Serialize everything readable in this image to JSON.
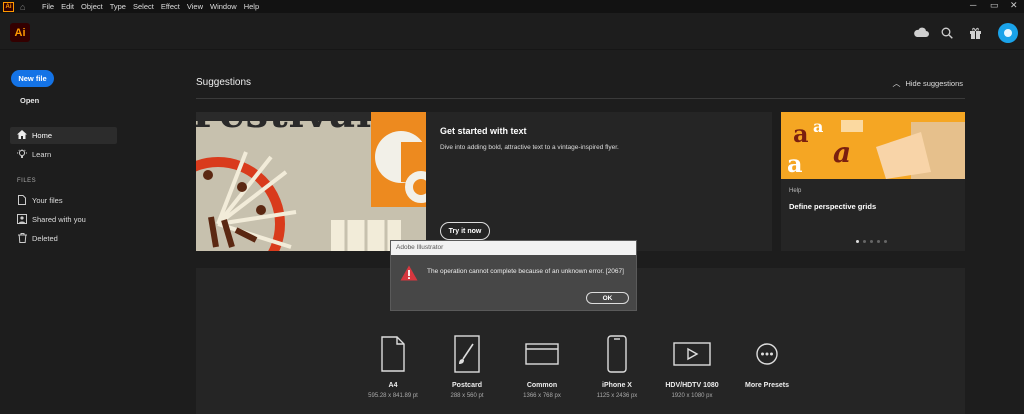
{
  "menubar": {
    "app_badge": "Ai",
    "items": [
      "File",
      "Edit",
      "Object",
      "Type",
      "Select",
      "Effect",
      "View",
      "Window",
      "Help"
    ]
  },
  "header": {
    "logo": "Ai",
    "icons": [
      "cloud-icon",
      "search-icon",
      "gift-icon",
      "avatar"
    ]
  },
  "sidebar": {
    "new_file": "New file",
    "open": "Open",
    "nav": [
      {
        "label": "Home",
        "icon": "home-icon",
        "active": true
      },
      {
        "label": "Learn",
        "icon": "bulb-icon",
        "active": false
      }
    ],
    "files_heading": "FILES",
    "files": [
      {
        "label": "Your files",
        "icon": "file-icon"
      },
      {
        "label": "Shared with you",
        "icon": "shared-icon"
      },
      {
        "label": "Deleted",
        "icon": "trash-icon"
      }
    ]
  },
  "suggestions": {
    "title": "Suggestions",
    "hide_label": "Hide suggestions",
    "card_main": {
      "art_text": "Festival",
      "title": "Get started with text",
      "description": "Dive into adding bold, attractive text to a vintage-inspired flyer.",
      "button": "Try it now"
    },
    "card_side": {
      "label": "Help",
      "title": "Define perspective grids"
    }
  },
  "presets": [
    {
      "name": "A4",
      "size": "595.28 x 841.89 pt",
      "icon": "document-icon"
    },
    {
      "name": "Postcard",
      "size": "288 x 560 pt",
      "icon": "brush-icon"
    },
    {
      "name": "Common",
      "size": "1366 x 768 px",
      "icon": "browser-icon"
    },
    {
      "name": "iPhone X",
      "size": "1125 x 2436 px",
      "icon": "phone-icon"
    },
    {
      "name": "HDV/HDTV 1080",
      "size": "1920 x 1080 px",
      "icon": "video-icon"
    },
    {
      "name": "More Presets",
      "size": "",
      "icon": "more-icon"
    }
  ],
  "dialog": {
    "title": "Adobe Illustrator",
    "message": "The operation cannot complete because of an unknown error.  [2067]",
    "ok": "OK"
  },
  "colors": {
    "accent": "#1473e6",
    "ai_orange": "#ff9a00",
    "warning_red": "#d7373f"
  }
}
